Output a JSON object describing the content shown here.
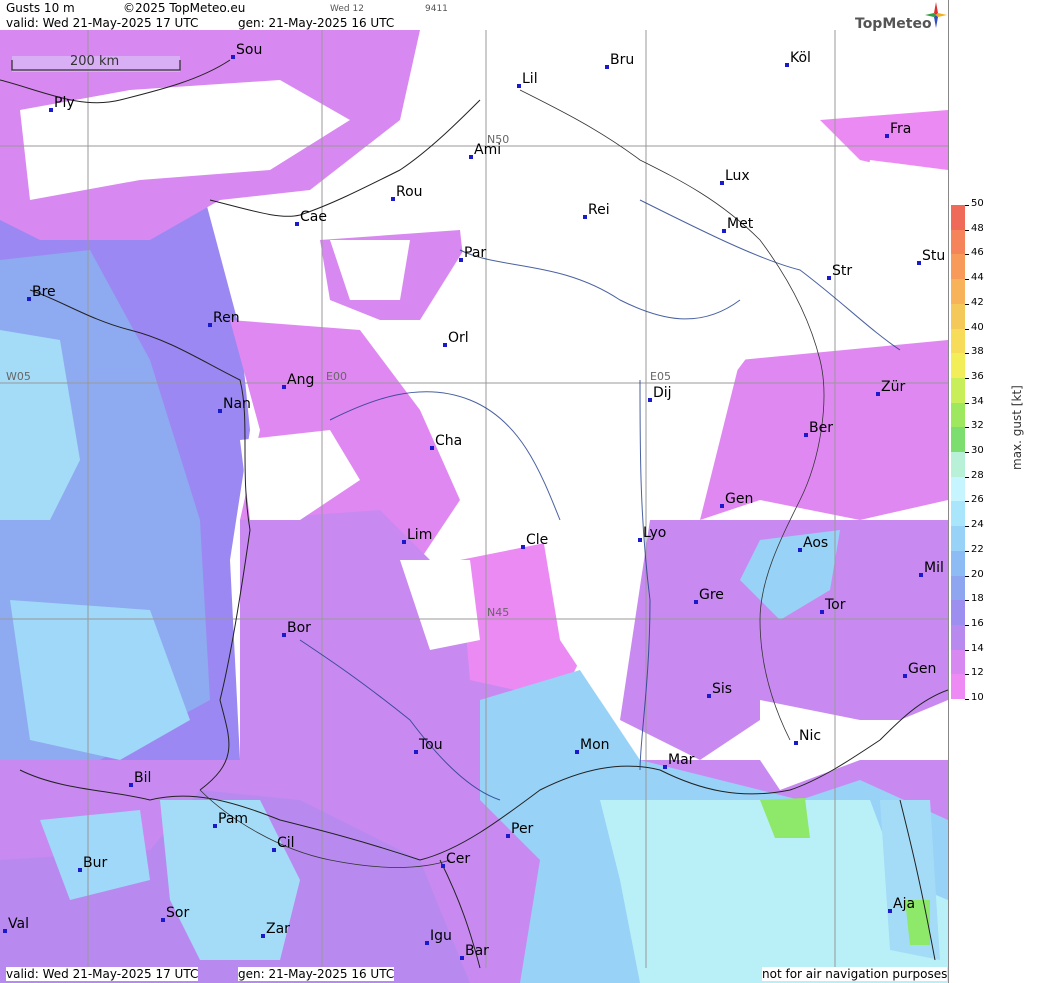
{
  "header": {
    "product": "Gusts 10 m",
    "copyright": "©2025 TopMeteo.eu",
    "day_label": "Wed 12",
    "code": "9411",
    "valid": "valid:  Wed  21-May-2025  17 UTC",
    "gen": "gen: 21-May-2025 16 UTC",
    "brand": "TopMeteo"
  },
  "footer": {
    "valid": "valid:  Wed  21-May-2025  17 UTC",
    "gen": "gen: 21-May-2025 16 UTC",
    "disclaimer": "not for air navigation purposes"
  },
  "scale_bar": {
    "label": "200 km"
  },
  "grid_labels": [
    "N50",
    "N45",
    "W05",
    "E00",
    "E05"
  ],
  "cities": [
    "Sou",
    "Bru",
    "Köl",
    "Lil",
    "Ply",
    "Fra",
    "Ami",
    "Lux",
    "Rou",
    "Cae",
    "Rei",
    "Met",
    "Par",
    "Stu",
    "Bre",
    "Str",
    "Ren",
    "Orl",
    "Ang",
    "Nan",
    "Dij",
    "Zür",
    "Cha",
    "Ber",
    "Gen",
    "Lim",
    "Cle",
    "Lyo",
    "Aos",
    "Mil",
    "Gre",
    "Tor",
    "Bor",
    "Gen",
    "Sis",
    "Nic",
    "Tou",
    "Mon",
    "Mar",
    "Bil",
    "Pam",
    "Cil",
    "Per",
    "Cer",
    "Bur",
    "Sor",
    "Zar",
    "Aja",
    "Val",
    "Igu",
    "Bar"
  ],
  "legend": {
    "title": "max. gust [kt]",
    "ticks": [
      "50",
      "48",
      "46",
      "44",
      "42",
      "40",
      "38",
      "36",
      "34",
      "32",
      "30",
      "28",
      "26",
      "24",
      "22",
      "20",
      "18",
      "16",
      "14",
      "12",
      "10"
    ],
    "colors": [
      "#f06a5a",
      "#f5845a",
      "#f79a5a",
      "#f7b25a",
      "#f5c85a",
      "#f7dc5a",
      "#f2ee5a",
      "#c8ee5a",
      "#9ee860",
      "#7cde6e",
      "#b9f0d8",
      "#c6f4ff",
      "#a9e6fb",
      "#98d2f6",
      "#8cbcf3",
      "#8ea6ef",
      "#9d8ff0",
      "#b88af0",
      "#d788f1",
      "#ee8af3"
    ]
  }
}
